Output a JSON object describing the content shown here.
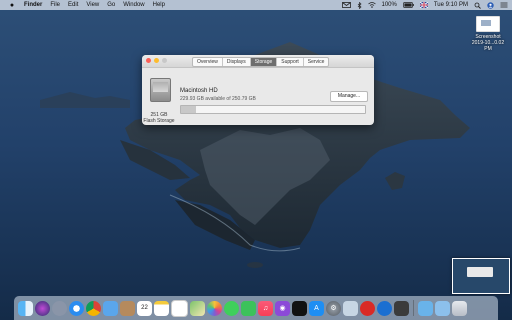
{
  "menubar": {
    "app_name": "Finder",
    "menus": [
      "File",
      "Edit",
      "View",
      "Go",
      "Window",
      "Help"
    ],
    "battery": "100%",
    "clock": "Tue 9:10 PM"
  },
  "desktop": {
    "screenshot_label_line1": "Screenshot",
    "screenshot_label_line2": "2019-10...0.02 PM"
  },
  "window": {
    "tabs": [
      "Overview",
      "Displays",
      "Storage",
      "Support",
      "Service"
    ],
    "active_tab": "Storage",
    "disk_size": "251 GB",
    "disk_type": "Flash Storage",
    "volume_name": "Macintosh HD",
    "volume_available": "229.93 GB available of 250.79 GB",
    "used_fraction": 0.083,
    "manage_label": "Manage..."
  },
  "colors": {
    "close": "#fc5f57",
    "minimize": "#fdbc2e",
    "zoom": "#28c840",
    "active_tab": "#6e6e6e"
  },
  "dock": {
    "apps": [
      "finder-icon",
      "siri-icon",
      "launchpad-icon",
      "safari-icon",
      "chrome-icon",
      "mail-icon",
      "contacts-icon",
      "calendar-icon",
      "notes-icon",
      "reminders-icon",
      "maps-icon",
      "photos-icon",
      "messages-icon",
      "facetime-icon",
      "music-icon",
      "podcasts-icon",
      "tv-icon",
      "app-store-icon",
      "system-preferences-icon",
      "preview-icon",
      "acrobat-icon",
      "screen-recorder-icon",
      "photo-booth-icon"
    ],
    "folders": [
      "folder-icon",
      "downloads-icon",
      "trash-icon"
    ]
  }
}
